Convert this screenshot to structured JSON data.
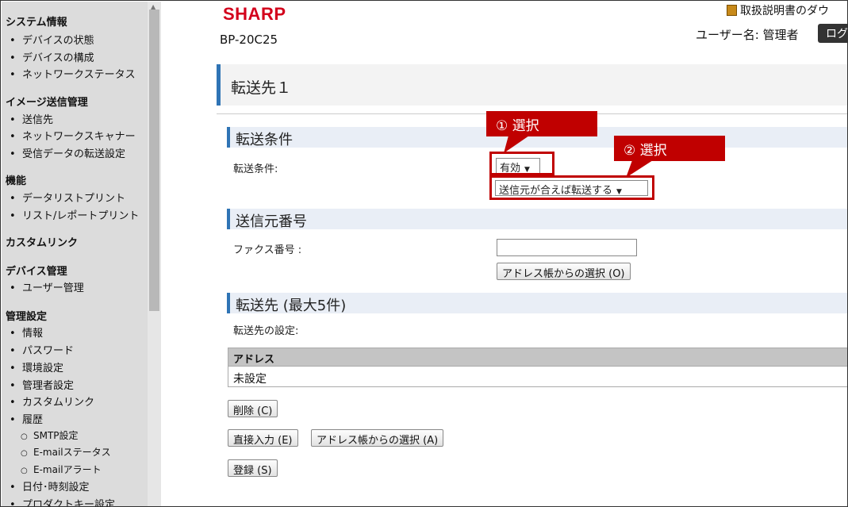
{
  "sidebar": {
    "groups": [
      {
        "title": "システム情報",
        "items": [
          "デバイスの状態",
          "デバイスの構成",
          "ネットワークステータス"
        ]
      },
      {
        "title": "イメージ送信管理",
        "items": [
          "送信先",
          "ネットワークスキャナー",
          "受信データの転送設定"
        ]
      },
      {
        "title": "機能",
        "items": [
          "データリストプリント",
          "リスト/レポートプリント"
        ]
      },
      {
        "title": "カスタムリンク",
        "items": []
      },
      {
        "title": "デバイス管理",
        "items": [
          "ユーザー管理"
        ]
      },
      {
        "title": "管理設定",
        "items": [
          "情報",
          "パスワード",
          "環境設定",
          "管理者設定",
          "カスタムリンク",
          "履歴",
          "日付･時刻設定",
          "プロダクトキー設定"
        ]
      }
    ],
    "history_sub": [
      "SMTP設定",
      "E-mailステータス",
      "E-mailアラート"
    ]
  },
  "header": {
    "brand": "SHARP",
    "model": "BP-20C25",
    "manual_link": "取扱説明書のダウ",
    "username": "ユーザー名: 管理者",
    "logout_label": "ログ"
  },
  "page": {
    "title": "転送先１"
  },
  "sections": {
    "condition": {
      "heading": "転送条件",
      "label": "転送条件:",
      "select1_value": "有効",
      "select2_value": "送信元が合えば転送する"
    },
    "sender": {
      "heading": "送信元番号",
      "fax_label": "ファクス番号 :",
      "fax_value": "",
      "addressbook_button": "アドレス帳からの選択 (O)"
    },
    "destination": {
      "heading": "転送先 (最大5件)",
      "setting_label": "転送先の設定:",
      "table_header": "アドレス",
      "table_rows": [
        "未設定"
      ],
      "delete_button": "削除 (C)",
      "direct_input_button": "直接入力 (E)",
      "addressbook_button": "アドレス帳からの選択 (A)",
      "register_button": "登録 (S)"
    }
  },
  "annotations": {
    "callout1": "① 選択",
    "callout2": "② 選択",
    "color": "#c00000"
  },
  "colors": {
    "accent": "#2f74b5",
    "brand": "#d3001c"
  }
}
